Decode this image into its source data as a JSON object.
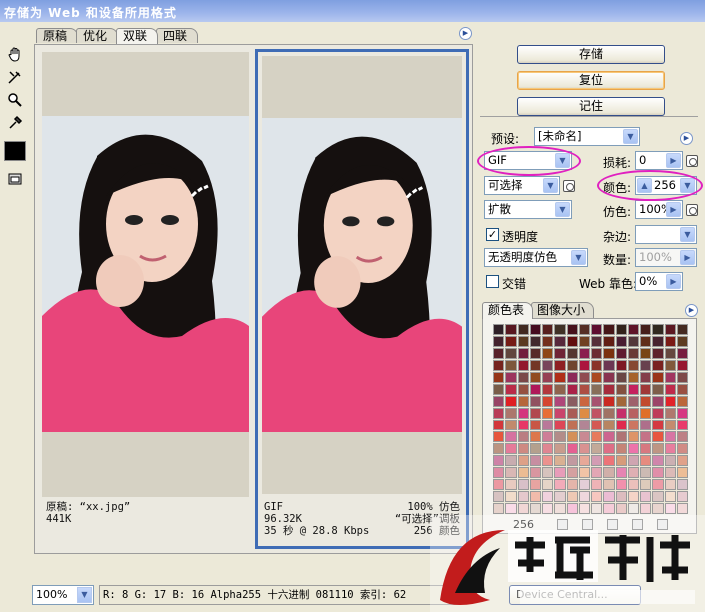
{
  "window": {
    "title": "存储为 Web 和设备所用格式"
  },
  "tabs": [
    {
      "label": "原稿",
      "active": false
    },
    {
      "label": "优化",
      "active": false
    },
    {
      "label": "双联",
      "active": true
    },
    {
      "label": "四联",
      "active": false
    }
  ],
  "tools": [
    "hand-tool-icon",
    "slice-select-tool-icon",
    "zoom-tool-icon",
    "eyedropper-tool-icon"
  ],
  "panes": {
    "original": {
      "name_line": "原稿: “xx.jpg”",
      "size": "441K"
    },
    "optimized": {
      "format": "GIF",
      "size": "96.32K",
      "time": "35 秒 @ 28.8 Kbps",
      "dither": "100% 仿色",
      "palette": "“可选择”调板",
      "colors": "256 颜色"
    }
  },
  "buttons": {
    "save": "存储",
    "reset": "复位",
    "remember": "记住"
  },
  "settings": {
    "preset_label": "预设:",
    "preset_value": "[未命名]",
    "format_value": "GIF",
    "lossy_label": "损耗:",
    "lossy_value": "0",
    "reduction_value": "可选择",
    "colors_label": "颜色:",
    "colors_value": "256",
    "dither_algo_value": "扩散",
    "dither_label": "仿色:",
    "dither_value": "100%",
    "transparency_label": "透明度",
    "transparency_checked": true,
    "matte_label": "杂边:",
    "matte_value": "",
    "transparency_dither_value": "无透明度仿色",
    "amount_label": "数量:",
    "amount_value": "100%",
    "interlaced_label": "交错",
    "interlaced_checked": false,
    "web_snap_label": "Web 靠色:",
    "web_snap_value": "0%"
  },
  "palette_tabs": [
    {
      "label": "颜色表",
      "active": true
    },
    {
      "label": "图像大小",
      "active": false
    }
  ],
  "palette": {
    "count": "256"
  },
  "statusbar": {
    "zoom": "100%",
    "readout": "R:   8  G:  17  B:  16  Alpha255  十六进制  081110  索引:  62",
    "device_central": "Device Central..."
  },
  "colors": {
    "selection_frame": "#3f6cb5",
    "annotation_ellipse": "#e020c0",
    "shirt_pink": "#e8457a"
  }
}
